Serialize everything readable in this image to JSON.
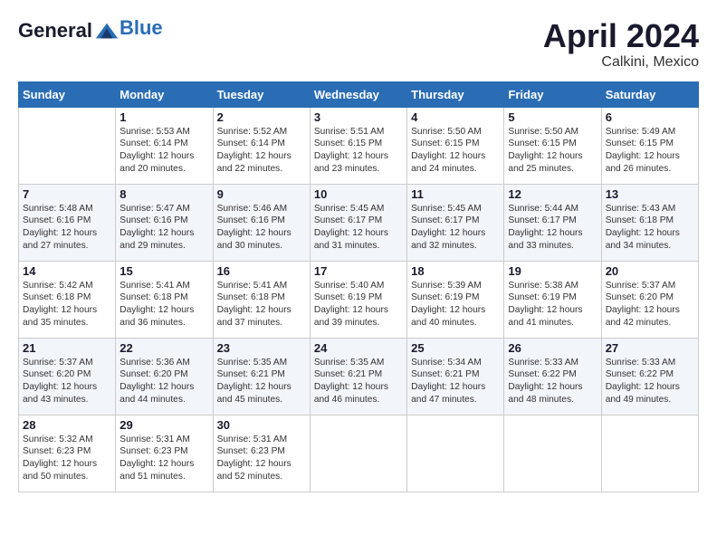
{
  "logo": {
    "text_general": "General",
    "text_blue": "Blue"
  },
  "header": {
    "month": "April 2024",
    "location": "Calkini, Mexico"
  },
  "days_of_week": [
    "Sunday",
    "Monday",
    "Tuesday",
    "Wednesday",
    "Thursday",
    "Friday",
    "Saturday"
  ],
  "weeks": [
    [
      {
        "day": "",
        "info": ""
      },
      {
        "day": "1",
        "info": "Sunrise: 5:53 AM\nSunset: 6:14 PM\nDaylight: 12 hours\nand 20 minutes."
      },
      {
        "day": "2",
        "info": "Sunrise: 5:52 AM\nSunset: 6:14 PM\nDaylight: 12 hours\nand 22 minutes."
      },
      {
        "day": "3",
        "info": "Sunrise: 5:51 AM\nSunset: 6:15 PM\nDaylight: 12 hours\nand 23 minutes."
      },
      {
        "day": "4",
        "info": "Sunrise: 5:50 AM\nSunset: 6:15 PM\nDaylight: 12 hours\nand 24 minutes."
      },
      {
        "day": "5",
        "info": "Sunrise: 5:50 AM\nSunset: 6:15 PM\nDaylight: 12 hours\nand 25 minutes."
      },
      {
        "day": "6",
        "info": "Sunrise: 5:49 AM\nSunset: 6:15 PM\nDaylight: 12 hours\nand 26 minutes."
      }
    ],
    [
      {
        "day": "7",
        "info": "Sunrise: 5:48 AM\nSunset: 6:16 PM\nDaylight: 12 hours\nand 27 minutes."
      },
      {
        "day": "8",
        "info": "Sunrise: 5:47 AM\nSunset: 6:16 PM\nDaylight: 12 hours\nand 29 minutes."
      },
      {
        "day": "9",
        "info": "Sunrise: 5:46 AM\nSunset: 6:16 PM\nDaylight: 12 hours\nand 30 minutes."
      },
      {
        "day": "10",
        "info": "Sunrise: 5:45 AM\nSunset: 6:17 PM\nDaylight: 12 hours\nand 31 minutes."
      },
      {
        "day": "11",
        "info": "Sunrise: 5:45 AM\nSunset: 6:17 PM\nDaylight: 12 hours\nand 32 minutes."
      },
      {
        "day": "12",
        "info": "Sunrise: 5:44 AM\nSunset: 6:17 PM\nDaylight: 12 hours\nand 33 minutes."
      },
      {
        "day": "13",
        "info": "Sunrise: 5:43 AM\nSunset: 6:18 PM\nDaylight: 12 hours\nand 34 minutes."
      }
    ],
    [
      {
        "day": "14",
        "info": "Sunrise: 5:42 AM\nSunset: 6:18 PM\nDaylight: 12 hours\nand 35 minutes."
      },
      {
        "day": "15",
        "info": "Sunrise: 5:41 AM\nSunset: 6:18 PM\nDaylight: 12 hours\nand 36 minutes."
      },
      {
        "day": "16",
        "info": "Sunrise: 5:41 AM\nSunset: 6:18 PM\nDaylight: 12 hours\nand 37 minutes."
      },
      {
        "day": "17",
        "info": "Sunrise: 5:40 AM\nSunset: 6:19 PM\nDaylight: 12 hours\nand 39 minutes."
      },
      {
        "day": "18",
        "info": "Sunrise: 5:39 AM\nSunset: 6:19 PM\nDaylight: 12 hours\nand 40 minutes."
      },
      {
        "day": "19",
        "info": "Sunrise: 5:38 AM\nSunset: 6:19 PM\nDaylight: 12 hours\nand 41 minutes."
      },
      {
        "day": "20",
        "info": "Sunrise: 5:37 AM\nSunset: 6:20 PM\nDaylight: 12 hours\nand 42 minutes."
      }
    ],
    [
      {
        "day": "21",
        "info": "Sunrise: 5:37 AM\nSunset: 6:20 PM\nDaylight: 12 hours\nand 43 minutes."
      },
      {
        "day": "22",
        "info": "Sunrise: 5:36 AM\nSunset: 6:20 PM\nDaylight: 12 hours\nand 44 minutes."
      },
      {
        "day": "23",
        "info": "Sunrise: 5:35 AM\nSunset: 6:21 PM\nDaylight: 12 hours\nand 45 minutes."
      },
      {
        "day": "24",
        "info": "Sunrise: 5:35 AM\nSunset: 6:21 PM\nDaylight: 12 hours\nand 46 minutes."
      },
      {
        "day": "25",
        "info": "Sunrise: 5:34 AM\nSunset: 6:21 PM\nDaylight: 12 hours\nand 47 minutes."
      },
      {
        "day": "26",
        "info": "Sunrise: 5:33 AM\nSunset: 6:22 PM\nDaylight: 12 hours\nand 48 minutes."
      },
      {
        "day": "27",
        "info": "Sunrise: 5:33 AM\nSunset: 6:22 PM\nDaylight: 12 hours\nand 49 minutes."
      }
    ],
    [
      {
        "day": "28",
        "info": "Sunrise: 5:32 AM\nSunset: 6:23 PM\nDaylight: 12 hours\nand 50 minutes."
      },
      {
        "day": "29",
        "info": "Sunrise: 5:31 AM\nSunset: 6:23 PM\nDaylight: 12 hours\nand 51 minutes."
      },
      {
        "day": "30",
        "info": "Sunrise: 5:31 AM\nSunset: 6:23 PM\nDaylight: 12 hours\nand 52 minutes."
      },
      {
        "day": "",
        "info": ""
      },
      {
        "day": "",
        "info": ""
      },
      {
        "day": "",
        "info": ""
      },
      {
        "day": "",
        "info": ""
      }
    ]
  ]
}
